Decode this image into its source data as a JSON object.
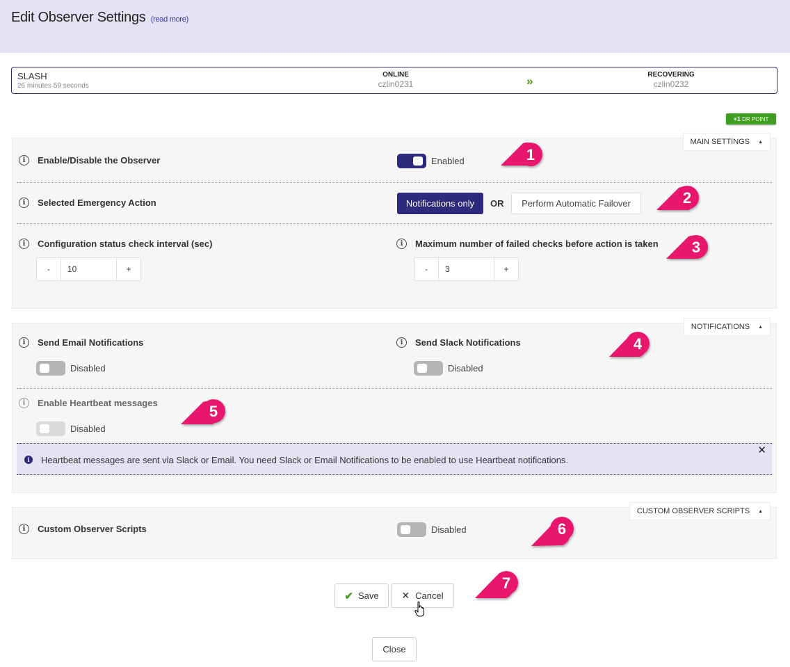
{
  "header": {
    "title": "Edit Observer Settings",
    "read_more": "(read more)"
  },
  "status": {
    "name": "SLASH",
    "duration": "26 minutes 59 seconds",
    "primary_label": "ONLINE",
    "primary_host": "czlin0231",
    "secondary_label": "RECOVERING",
    "secondary_host": "czlin0232",
    "arrow": "»"
  },
  "badge": {
    "plus": "+1",
    "text": "DR POINT"
  },
  "main_settings": {
    "tab_label": "MAIN SETTINGS",
    "enable_label": "Enable/Disable the Observer",
    "enable_state": "Enabled",
    "emergency_label": "Selected Emergency Action",
    "action_selected": "Notifications only",
    "or_text": "OR",
    "action_other": "Perform Automatic Failover",
    "interval_label": "Configuration status check interval (sec)",
    "interval_value": "10",
    "max_failed_label": "Maximum number of failed checks before action is taken",
    "max_failed_value": "3",
    "minus": "-",
    "plus": "+"
  },
  "notifications": {
    "tab_label": "NOTIFICATIONS",
    "email_label": "Send Email Notifications",
    "email_state": "Disabled",
    "slack_label": "Send Slack Notifications",
    "slack_state": "Disabled",
    "heartbeat_label": "Enable Heartbeat messages",
    "heartbeat_state": "Disabled",
    "alert_text": "Heartbeat messages are sent via Slack or Email. You need Slack or Email Notifications to be enabled to use Heartbeat notifications.",
    "alert_close": "✕"
  },
  "scripts": {
    "tab_label": "CUSTOM OBSERVER SCRIPTS",
    "label": "Custom Observer Scripts",
    "state": "Disabled"
  },
  "actions": {
    "save": "Save",
    "cancel": "Cancel",
    "close": "Close"
  },
  "callouts": [
    "1",
    "2",
    "3",
    "4",
    "5",
    "6",
    "7"
  ],
  "colors": {
    "accent": "#2d2a7c",
    "header_bg": "#e3e3f5",
    "callout": "#e8146c",
    "badge": "#3f9d1f"
  },
  "icons": {
    "info": "info-icon",
    "check": "check-icon",
    "cancel": "x-icon",
    "caret": "caret-up-icon",
    "cursor": "hand-cursor-icon"
  }
}
